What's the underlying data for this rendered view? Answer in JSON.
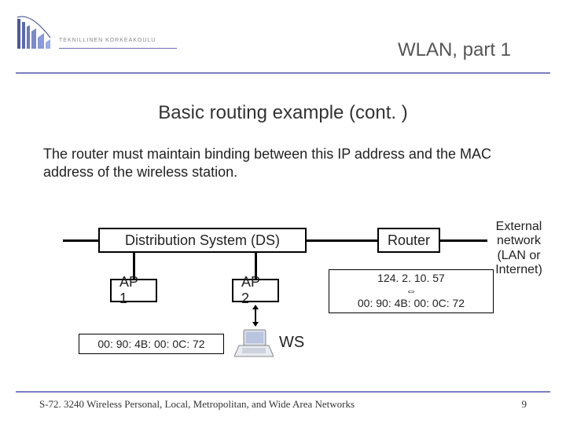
{
  "header": {
    "institution": "TEKNILLINEN KORKEAKOULU",
    "course_title": "WLAN, part 1"
  },
  "slide": {
    "title": "Basic routing example (cont. )",
    "body": "The router must maintain binding between this IP address and the MAC address of the wireless station."
  },
  "diagram": {
    "ds_label": "Distribution System (DS)",
    "router_label": "Router",
    "ap1_label": "AP 1",
    "ap2_label": "AP 2",
    "mac_ap1": "00: 90: 4B: 00: 0C: 72",
    "binding_ip": "124. 2. 10. 57",
    "binding_arrow": "⇔",
    "binding_mac": "00: 90: 4B: 00: 0C: 72",
    "ws_label": "WS",
    "external_text": "External network (LAN or Internet)"
  },
  "footer": {
    "text": "S-72. 3240 Wireless Personal, Local, Metropolitan, and Wide Area Networks",
    "page": "9"
  }
}
